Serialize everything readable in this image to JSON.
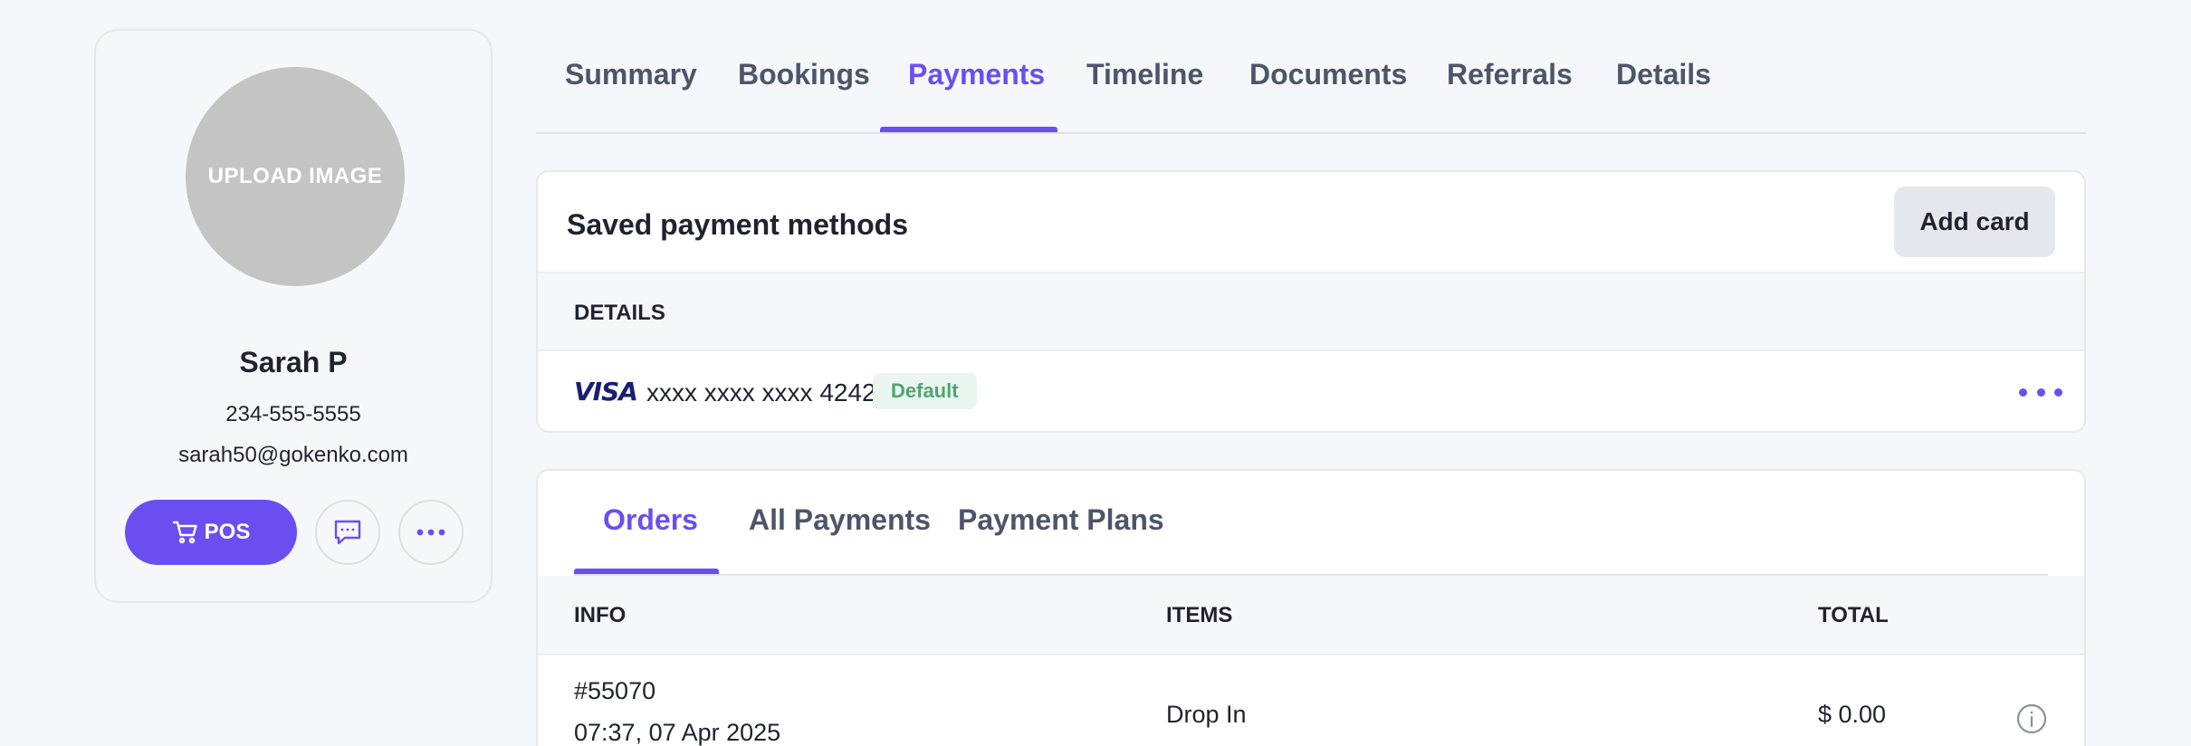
{
  "profile": {
    "avatar_label": "UPLOAD IMAGE",
    "name": "Sarah P",
    "phone": "234-555-5555",
    "email": "sarah50@gokenko.com",
    "pos_label": "POS"
  },
  "top_tabs": [
    {
      "label": "Summary",
      "active": false
    },
    {
      "label": "Bookings",
      "active": false
    },
    {
      "label": "Payments",
      "active": true
    },
    {
      "label": "Timeline",
      "active": false
    },
    {
      "label": "Documents",
      "active": false
    },
    {
      "label": "Referrals",
      "active": false
    },
    {
      "label": "Details",
      "active": false
    }
  ],
  "payment_methods": {
    "title": "Saved payment methods",
    "add_button": "Add card",
    "details_header": "DETAILS",
    "card": {
      "brand": "VISA",
      "number": "xxxx xxxx xxxx 4242",
      "badge": "Default"
    }
  },
  "orders": {
    "tabs": [
      {
        "label": "Orders",
        "active": true
      },
      {
        "label": "All Payments",
        "active": false
      },
      {
        "label": "Payment Plans",
        "active": false
      }
    ],
    "columns": {
      "info": "INFO",
      "items": "ITEMS",
      "total": "TOTAL"
    },
    "rows": [
      {
        "id": "#55070",
        "time": "07:37, 07 Apr 2025",
        "items": "Drop In",
        "total": "$ 0.00"
      }
    ]
  },
  "colors": {
    "accent": "#6b4ef0",
    "badge_bg": "#ebf5ef",
    "badge_text": "#4fa56e"
  }
}
